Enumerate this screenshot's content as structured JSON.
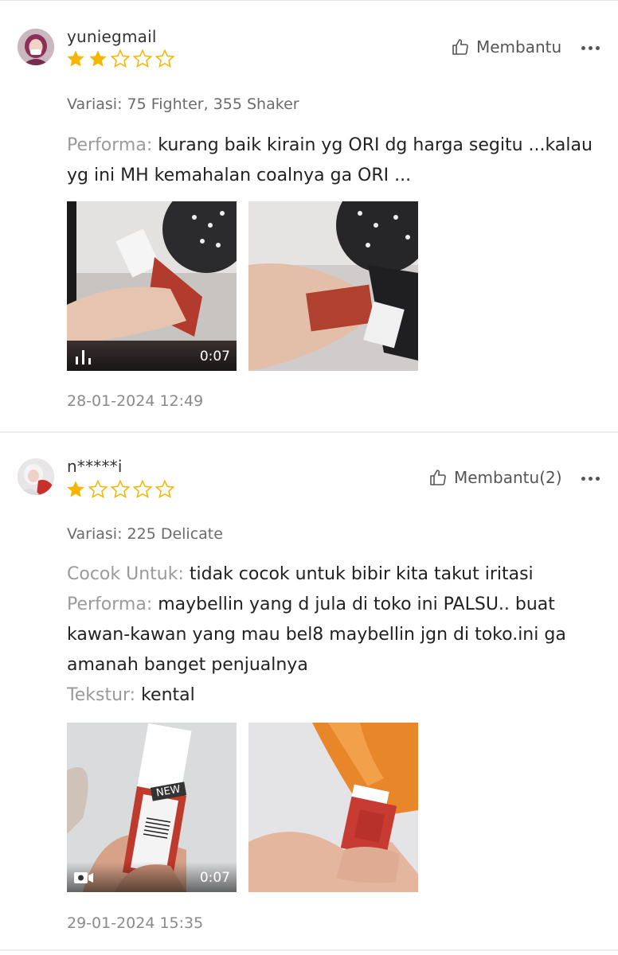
{
  "colors": {
    "star_filled": "#f6b500",
    "star_empty": "#f6b500",
    "label_gray": "#9a9a9a",
    "text": "#222222"
  },
  "reviews": [
    {
      "username": "yuniegmail",
      "rating": 2,
      "max_rating": 5,
      "helpful_label": "Membantu",
      "variant": "Variasi: 75 Fighter, 355 Shaker",
      "fields": [
        {
          "label": "Performa:",
          "value": "kurang baik kirain yg ORI dg harga segitu ...kalau yg ini MH kemahalan coalnya ga ORI ..."
        }
      ],
      "media": [
        {
          "type": "video",
          "duration": "0:07",
          "icon": "audio-bars-icon"
        },
        {
          "type": "image"
        }
      ],
      "timestamp": "28-01-2024 12:49"
    },
    {
      "username": "n*****i",
      "rating": 1,
      "max_rating": 5,
      "helpful_label": "Membantu(2)",
      "variant": "Variasi: 225 Delicate",
      "fields": [
        {
          "label": "Cocok Untuk:",
          "value": "tidak cocok untuk bibir kita takut iritasi"
        },
        {
          "label": "Performa:",
          "value": "maybellin yang d jula di toko ini PALSU.. buat kawan-kawan yang mau bel8 maybellin jgn di toko.ini ga amanah banget penjualnya"
        },
        {
          "label": "Tekstur:",
          "value": "kental"
        }
      ],
      "media": [
        {
          "type": "video",
          "duration": "0:07",
          "icon": "video-camera-icon",
          "product_badge": "NEW"
        },
        {
          "type": "image"
        }
      ],
      "timestamp": "29-01-2024 15:35"
    }
  ]
}
